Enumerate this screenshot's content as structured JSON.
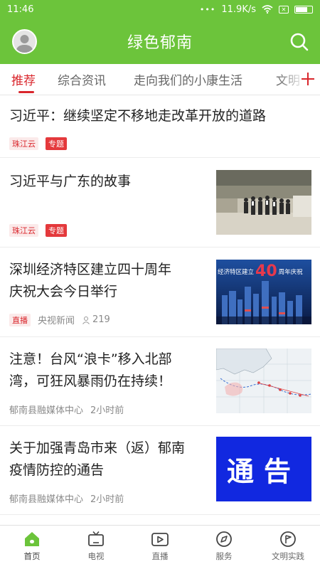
{
  "status": {
    "time": "11:46",
    "speed": "11.9K/s"
  },
  "header": {
    "title": "绿色郁南"
  },
  "tabs": [
    {
      "label": "推荐"
    },
    {
      "label": "综合资讯"
    },
    {
      "label": "走向我们的小康生活"
    },
    {
      "label": "文明"
    }
  ],
  "feed": [
    {
      "title": "习近平：继续坚定不移地走改革开放的道路",
      "source_tag": "珠江云",
      "topic_tag": "专题"
    },
    {
      "title": "习近平与广东的故事",
      "source_tag": "珠江云",
      "topic_tag": "专题"
    },
    {
      "title_line1": "深圳经济特区建立四十周年",
      "title_line2": "庆祝大会今日举行",
      "live_tag": "直播",
      "source": "央视新闻",
      "views": "219",
      "thumb_text": "经济特区建立",
      "thumb_number": "40",
      "thumb_suffix": "周年庆祝"
    },
    {
      "title_line1": "注意！台风“浪卡”移入北部",
      "title_line2": "湾，可狂风暴雨仍在持续！",
      "source": "郁南县融媒体中心",
      "time": "2小时前"
    },
    {
      "title_line1": "关于加强青岛市来（返）郁南",
      "title_line2": "疫情防控的通告",
      "source": "郁南县融媒体中心",
      "time": "2小时前",
      "thumb_text": "通告"
    }
  ],
  "nav": [
    {
      "label": "首页",
      "icon": "home-icon"
    },
    {
      "label": "电视",
      "icon": "tv-icon"
    },
    {
      "label": "直播",
      "icon": "live-video-icon"
    },
    {
      "label": "服务",
      "icon": "compass-icon"
    },
    {
      "label": "文明实践",
      "icon": "flag-icon"
    }
  ],
  "colors": {
    "brand_green": "#6cc43b",
    "accent_red": "#d9262c",
    "notice_blue": "#1128e0"
  }
}
